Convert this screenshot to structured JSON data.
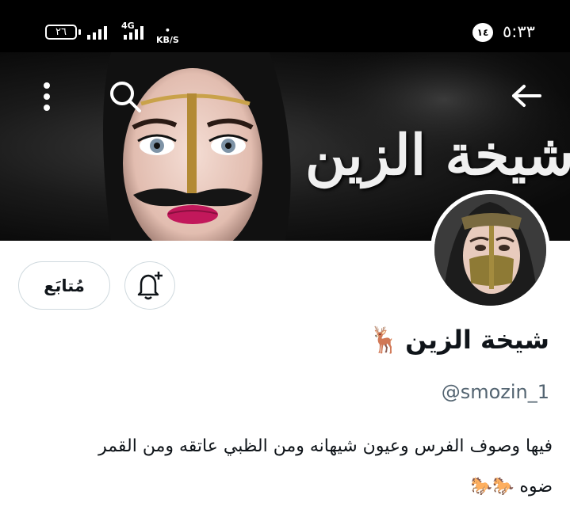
{
  "status_bar": {
    "battery": "٢٦",
    "network": "4G",
    "speed_value": "•",
    "speed_unit": "KB/S",
    "notification_count": "١٤",
    "time": "٥:٣٣"
  },
  "banner": {
    "title": "شيخة الزين"
  },
  "actions": {
    "follow_label": "مُتابَع"
  },
  "profile": {
    "display_name": "شيخة الزين",
    "name_emoji": "🦌",
    "handle": "@smozin_1",
    "bio_line1": "فيها وصوف الفرس وعيون شيهانه ومن الظبي عاتقه ومن القمر",
    "bio_line2": "ضوه",
    "bio_emoji": "🐎🐎"
  },
  "colors": {
    "text_primary": "#0f1419",
    "text_secondary": "#536471",
    "border": "#cfd9de",
    "status_bar_bg": "#000000"
  },
  "icons": [
    "back-arrow-icon",
    "search-icon",
    "more-vertical-icon",
    "bell-plus-icon"
  ]
}
